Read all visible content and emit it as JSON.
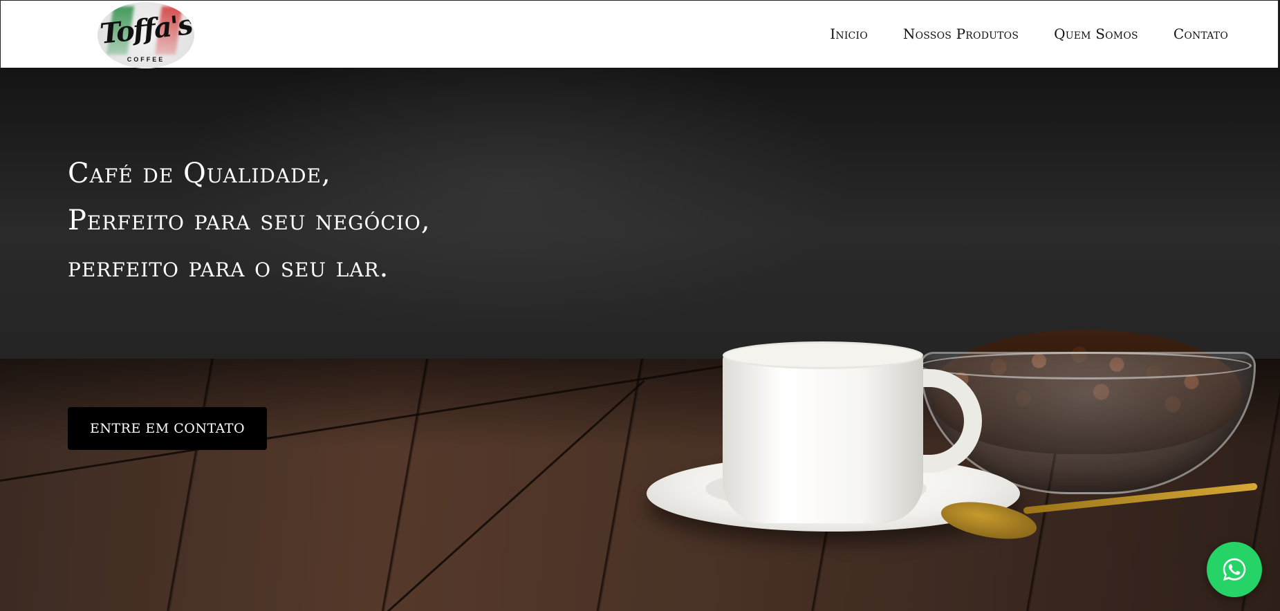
{
  "logo": {
    "wordmark": "Toffa's",
    "subtitle": "COFFEE"
  },
  "nav": {
    "items": [
      {
        "label": "Inicio"
      },
      {
        "label": "Nossos Produtos"
      },
      {
        "label": "Quem Somos"
      },
      {
        "label": "Contato"
      }
    ]
  },
  "hero": {
    "headline_lines": [
      "Café de Qualidade,",
      "Perfeito para seu negócio,",
      "perfeito para o seu lar."
    ],
    "cta_label": "ENTRE EM CONTATO"
  },
  "floating": {
    "icon": "whatsapp-icon",
    "color": "#25d366"
  }
}
